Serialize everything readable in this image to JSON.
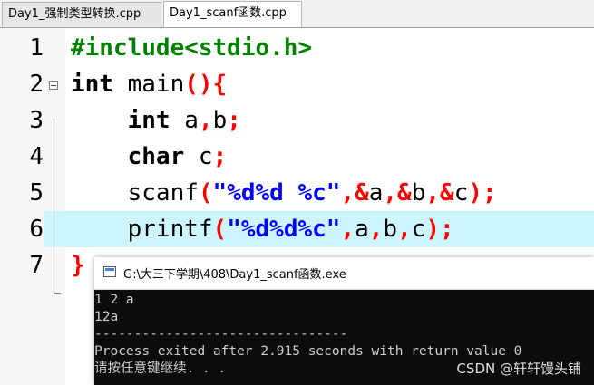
{
  "tabs": [
    {
      "label": "Day1_强制类型转换.cpp",
      "active": false
    },
    {
      "label": "Day1_scanf函数.cpp",
      "active": true
    }
  ],
  "editor": {
    "line_numbers": [
      "1",
      "2",
      "3",
      "4",
      "5",
      "6",
      "7"
    ],
    "current_line": 6,
    "lines": [
      [
        {
          "t": "#include<stdio.h>",
          "c": "pp"
        }
      ],
      [
        {
          "t": "int",
          "c": "kw"
        },
        {
          "t": " main",
          "c": ""
        },
        {
          "t": "(){",
          "c": "sym"
        }
      ],
      [
        {
          "t": "    ",
          "c": ""
        },
        {
          "t": "int",
          "c": "kw"
        },
        {
          "t": " a",
          "c": ""
        },
        {
          "t": ",",
          "c": "sym"
        },
        {
          "t": "b",
          "c": ""
        },
        {
          "t": ";",
          "c": "sym"
        }
      ],
      [
        {
          "t": "    ",
          "c": ""
        },
        {
          "t": "char",
          "c": "kw"
        },
        {
          "t": " c",
          "c": ""
        },
        {
          "t": ";",
          "c": "sym"
        }
      ],
      [
        {
          "t": "    scanf",
          "c": ""
        },
        {
          "t": "(",
          "c": "sym"
        },
        {
          "t": "\"%d%d %c\"",
          "c": "str"
        },
        {
          "t": ",&",
          "c": "sym"
        },
        {
          "t": "a",
          "c": ""
        },
        {
          "t": ",&",
          "c": "sym"
        },
        {
          "t": "b",
          "c": ""
        },
        {
          "t": ",&",
          "c": "sym"
        },
        {
          "t": "c",
          "c": ""
        },
        {
          "t": ");",
          "c": "sym"
        }
      ],
      [
        {
          "t": "    printf",
          "c": ""
        },
        {
          "t": "(",
          "c": "sym"
        },
        {
          "t": "\"%d%d%c\"",
          "c": "str"
        },
        {
          "t": ",",
          "c": "sym"
        },
        {
          "t": "a",
          "c": ""
        },
        {
          "t": ",",
          "c": "sym"
        },
        {
          "t": "b",
          "c": ""
        },
        {
          "t": ",",
          "c": "sym"
        },
        {
          "t": "c",
          "c": ""
        },
        {
          "t": ");",
          "c": "sym"
        }
      ],
      [
        {
          "t": "}",
          "c": "sym"
        }
      ]
    ]
  },
  "console": {
    "title": "G:\\大三下学期\\408\\Day1_scanf函数.exe",
    "output": [
      "1 2 a",
      "12a",
      "--------------------------------",
      "Process exited after 2.915 seconds with return value 0",
      "请按任意键继续. . ."
    ]
  },
  "watermark": "CSDN @轩轩馒头铺",
  "colors": {
    "keyword": "#000000",
    "preprocessor": "#008000",
    "symbol": "#ff0000",
    "string": "#0000ff",
    "current_line_bg": "#ccf5ff",
    "console_bg": "#0c0c0c",
    "console_text": "#cccccc"
  },
  "icons": [
    "fold-minus-icon",
    "console-app-icon"
  ]
}
